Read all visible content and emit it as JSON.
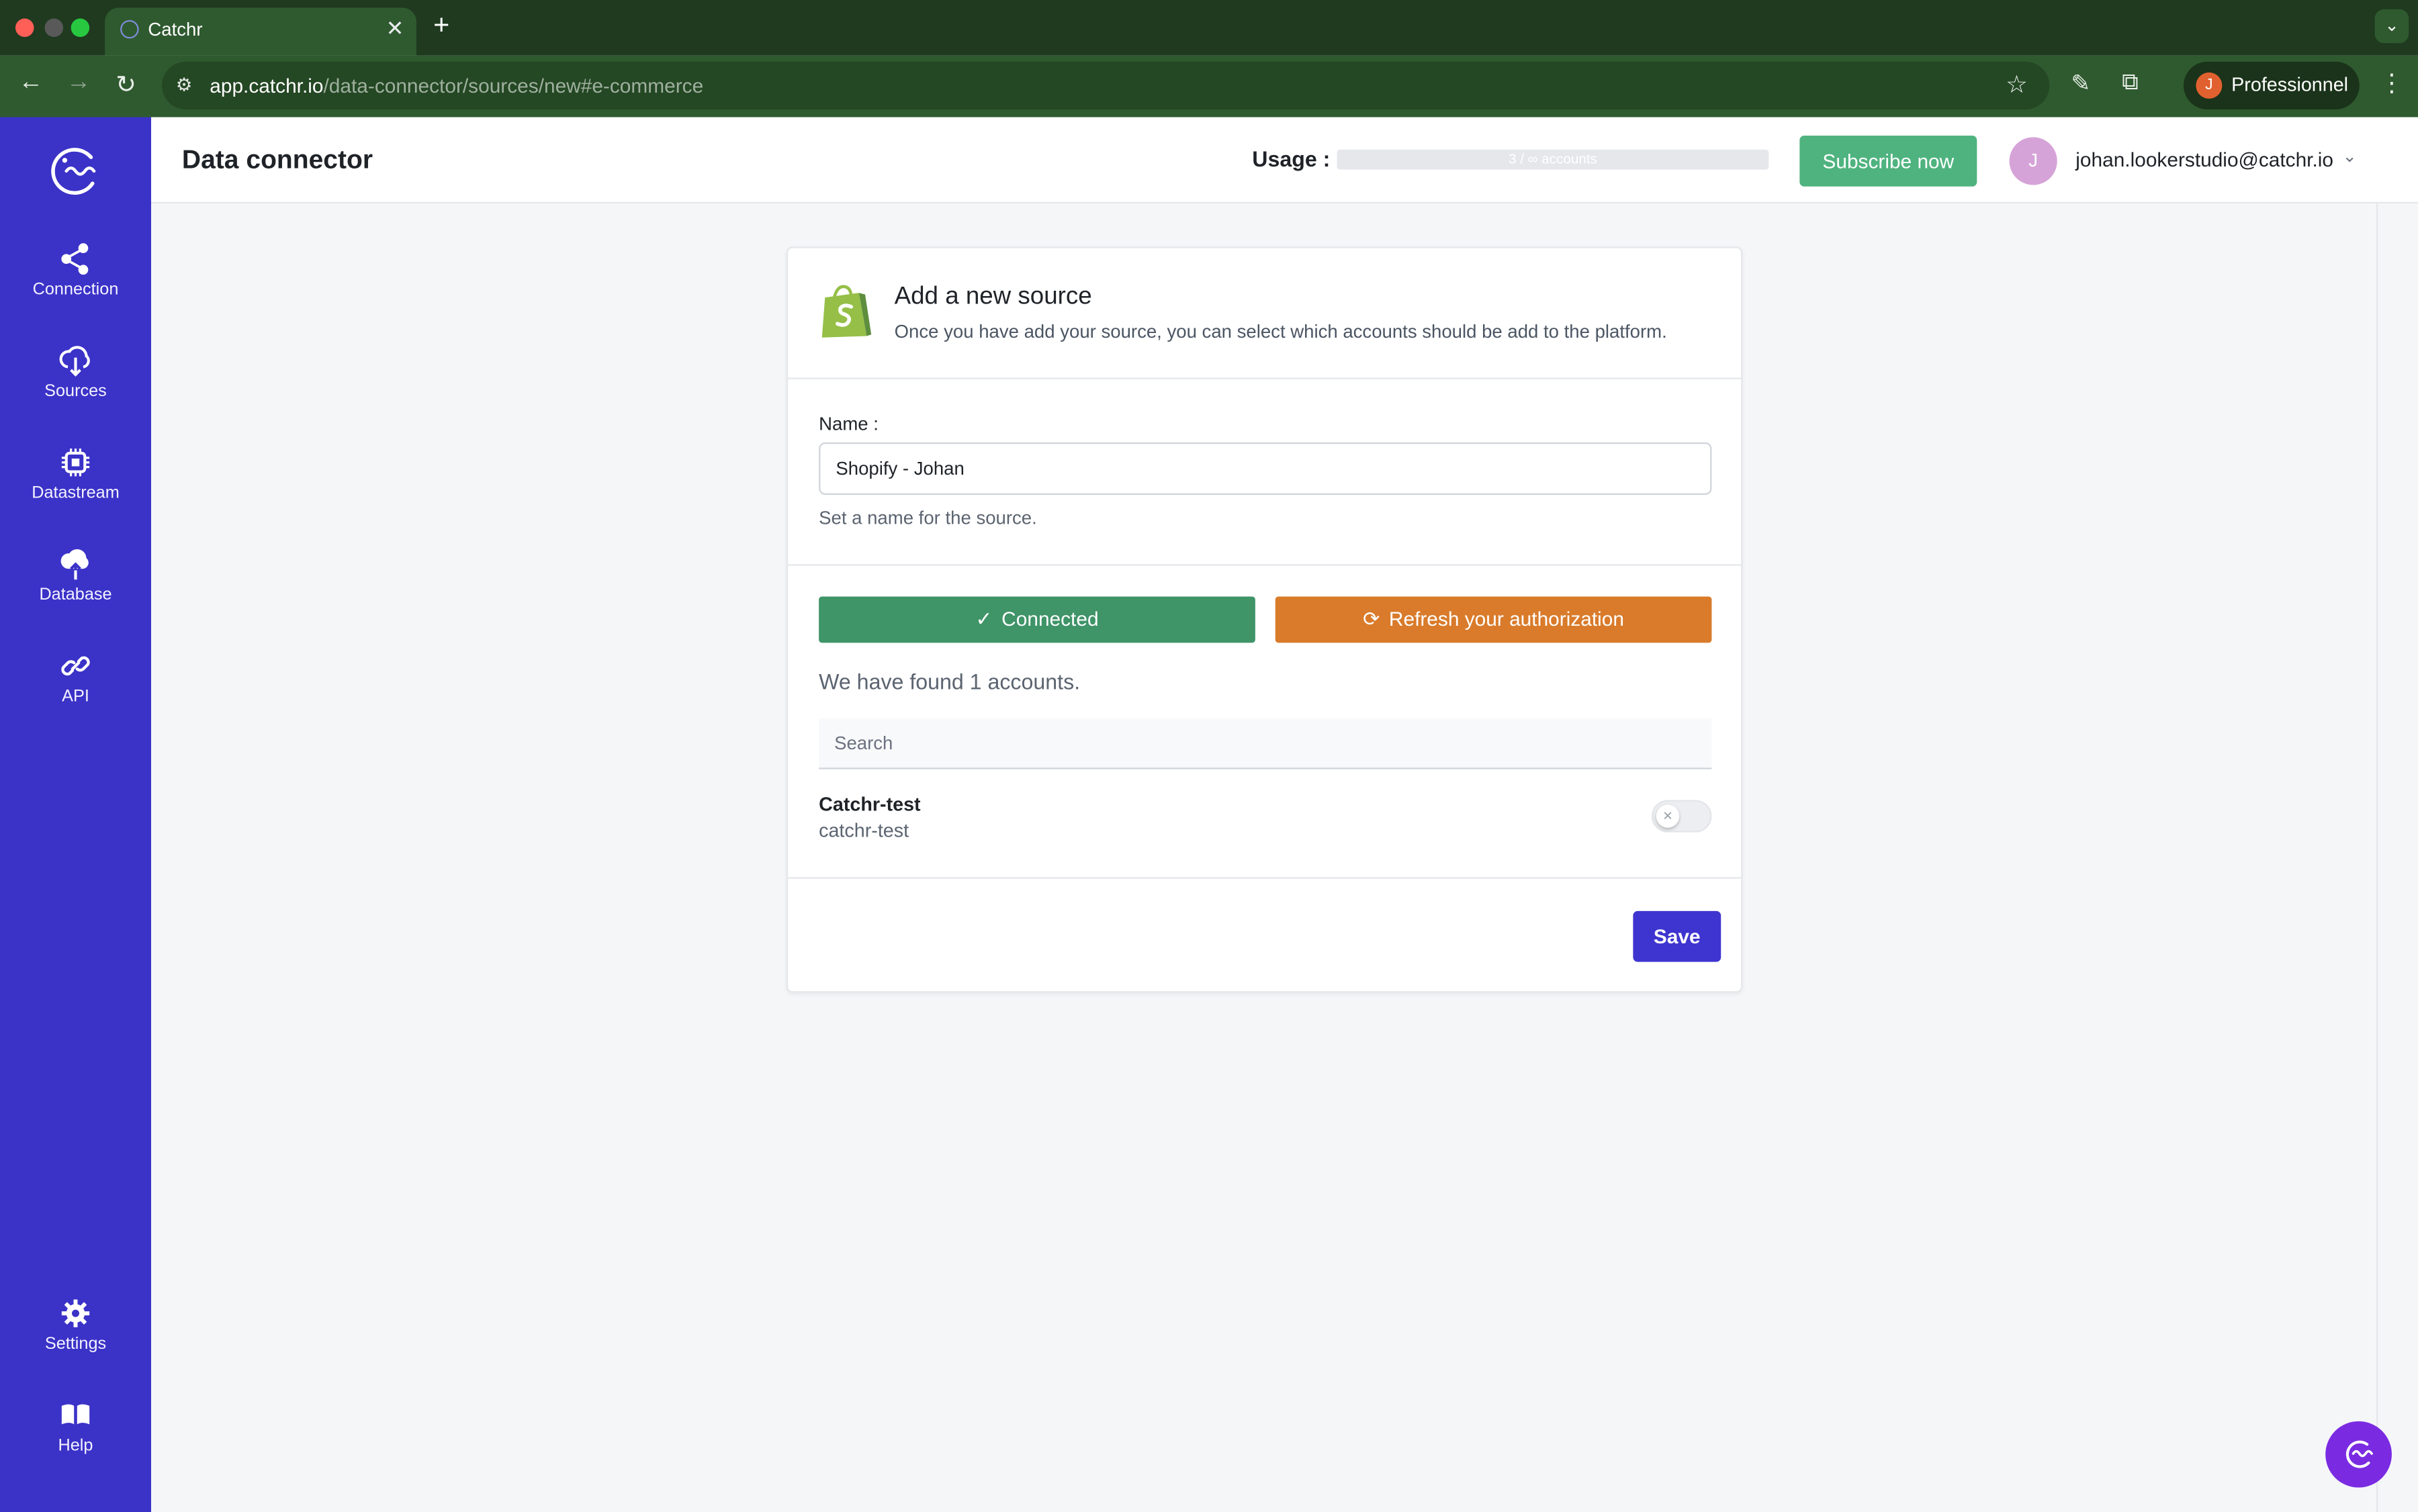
{
  "browser": {
    "tab_title": "Catchr",
    "url_host": "app.catchr.io",
    "url_path": "/data-connector/sources/new#e-commerce",
    "profile_initial": "J",
    "profile_name": "Professionnel"
  },
  "sidebar": {
    "items": [
      {
        "label": "Connection",
        "icon": "share-icon"
      },
      {
        "label": "Sources",
        "icon": "cloud-download-icon"
      },
      {
        "label": "Datastream",
        "icon": "chip-icon"
      },
      {
        "label": "Database",
        "icon": "cloud-upload-icon"
      },
      {
        "label": "API",
        "icon": "link-icon"
      }
    ],
    "bottom_items": [
      {
        "label": "Settings",
        "icon": "gear-icon"
      },
      {
        "label": "Help",
        "icon": "book-icon"
      }
    ]
  },
  "header": {
    "title": "Data connector",
    "usage_label": "Usage :",
    "usage_text": "3 / ∞ accounts",
    "subscribe_label": "Subscribe now",
    "user_initial": "J",
    "user_email": "johan.lookerstudio@catchr.io"
  },
  "card": {
    "title": "Add a new source",
    "subtitle": "Once you have add your source, you can select which accounts should be add to the platform.",
    "name_label": "Name :",
    "name_value": "Shopify - Johan",
    "name_help": "Set a name for the source.",
    "connected_label": "Connected",
    "refresh_label": "Refresh your authorization",
    "found_text": "We have found 1 accounts.",
    "search_placeholder": "Search",
    "accounts": [
      {
        "name": "Catchr-test",
        "id": "catchr-test",
        "enabled": false
      }
    ],
    "save_label": "Save"
  },
  "colors": {
    "sidebar": "#3b32c8",
    "connected": "#3f9468",
    "refresh": "#d97b2b",
    "save": "#3e35d0",
    "subscribe": "#4fb37f",
    "shopify": "#95bf47"
  }
}
